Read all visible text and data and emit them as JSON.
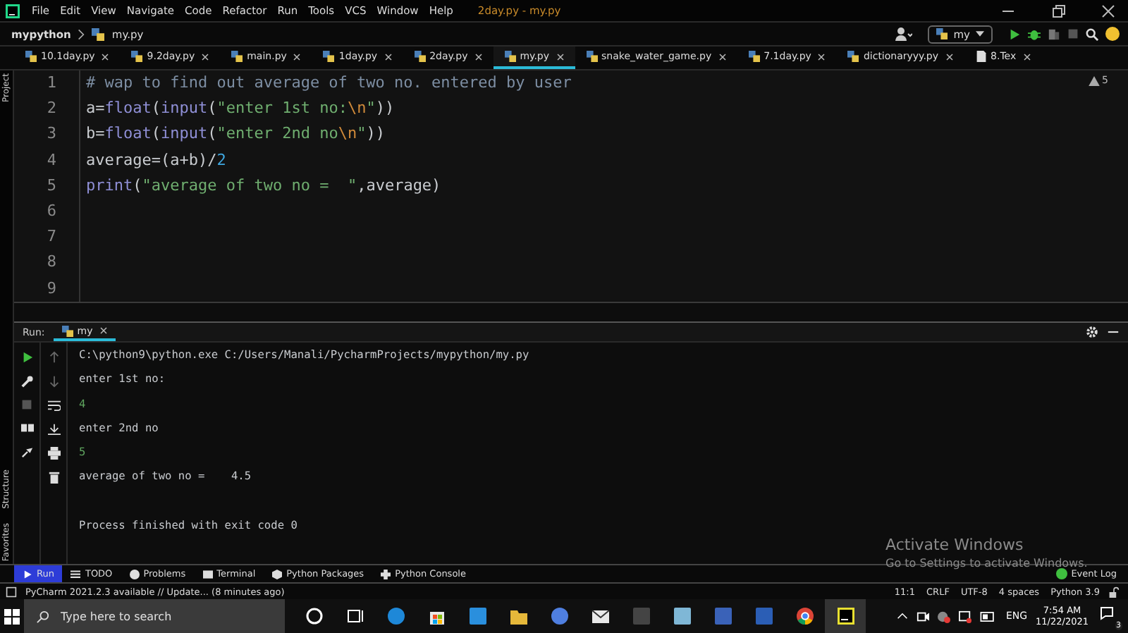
{
  "menu_bar": {
    "items": [
      "File",
      "Edit",
      "View",
      "Navigate",
      "Code",
      "Refactor",
      "Run",
      "Tools",
      "VCS",
      "Window",
      "Help"
    ],
    "title": "2day.py - my.py"
  },
  "nav_bar": {
    "project": "mypython",
    "file": "my.py",
    "run_config": "my"
  },
  "editor_tabs": [
    {
      "label": "10.1day.py",
      "kind": "python",
      "selected": false
    },
    {
      "label": "9.2day.py",
      "kind": "python",
      "selected": false
    },
    {
      "label": "main.py",
      "kind": "python",
      "selected": false
    },
    {
      "label": "1day.py",
      "kind": "python",
      "selected": false
    },
    {
      "label": "2day.py",
      "kind": "python",
      "selected": false
    },
    {
      "label": "my.py",
      "kind": "python",
      "selected": true
    },
    {
      "label": "snake_water_game.py",
      "kind": "python",
      "selected": false
    },
    {
      "label": "7.1day.py",
      "kind": "python",
      "selected": false
    },
    {
      "label": "dictionaryyy.py",
      "kind": "python",
      "selected": false
    },
    {
      "label": "8.Tex",
      "kind": "text",
      "selected": false
    }
  ],
  "side_tabs": [
    "Project",
    "Structure",
    "Favorites"
  ],
  "editor": {
    "warnings": "5",
    "lines": [
      {
        "number": "1",
        "tokens": [
          {
            "kind": "comment",
            "text": "# wap to find out average of two no. entered by user"
          }
        ]
      },
      {
        "number": "2",
        "tokens": [
          {
            "kind": "plain",
            "text": "a"
          },
          {
            "kind": "plain",
            "text": "="
          },
          {
            "kind": "builtin",
            "text": "float"
          },
          {
            "kind": "plain",
            "text": "("
          },
          {
            "kind": "builtin",
            "text": "input"
          },
          {
            "kind": "plain",
            "text": "("
          },
          {
            "kind": "string",
            "text": "\"enter 1st no:"
          },
          {
            "kind": "escape",
            "text": "\\n"
          },
          {
            "kind": "string",
            "text": "\""
          },
          {
            "kind": "plain",
            "text": "))"
          }
        ]
      },
      {
        "number": "3",
        "tokens": [
          {
            "kind": "plain",
            "text": "b"
          },
          {
            "kind": "plain",
            "text": "="
          },
          {
            "kind": "builtin",
            "text": "float"
          },
          {
            "kind": "plain",
            "text": "("
          },
          {
            "kind": "builtin",
            "text": "input"
          },
          {
            "kind": "plain",
            "text": "("
          },
          {
            "kind": "string",
            "text": "\"enter 2nd no"
          },
          {
            "kind": "escape",
            "text": "\\n"
          },
          {
            "kind": "string",
            "text": "\""
          },
          {
            "kind": "plain",
            "text": "))"
          }
        ]
      },
      {
        "number": "4",
        "tokens": [
          {
            "kind": "plain",
            "text": "average=(a+b)/"
          },
          {
            "kind": "number",
            "text": "2"
          }
        ]
      },
      {
        "number": "5",
        "tokens": [
          {
            "kind": "builtin",
            "text": "print"
          },
          {
            "kind": "plain",
            "text": "("
          },
          {
            "kind": "string",
            "text": "\"average of two no =  \""
          },
          {
            "kind": "plain",
            "text": ",average)"
          }
        ]
      },
      {
        "number": "6"
      },
      {
        "number": "7"
      },
      {
        "number": "8"
      },
      {
        "number": "9"
      }
    ]
  },
  "run_panel": {
    "label": "Run:",
    "tab": "my",
    "output": [
      {
        "kind": "stdout",
        "text": "C:\\python9\\python.exe C:/Users/Manali/PycharmProjects/mypython/my.py"
      },
      {
        "kind": "stdout",
        "text": "enter 1st no:"
      },
      {
        "kind": "input",
        "text": "4"
      },
      {
        "kind": "stdout",
        "text": "enter 2nd no"
      },
      {
        "kind": "input",
        "text": "5"
      },
      {
        "kind": "stdout",
        "text": "average of two no =    4.5"
      },
      {
        "kind": "blank"
      },
      {
        "kind": "stdout",
        "text": "Process finished with exit code 0"
      }
    ]
  },
  "tool_windows": [
    {
      "label": "Run",
      "selected": true
    },
    {
      "label": "TODO",
      "selected": false
    },
    {
      "label": "Problems",
      "selected": false
    },
    {
      "label": "Terminal",
      "selected": false
    },
    {
      "label": "Python Packages",
      "selected": false
    },
    {
      "label": "Python Console",
      "selected": false
    }
  ],
  "event_log": "Event Log",
  "status_bar": {
    "message": "PyCharm 2021.2.3 available // Update... (8 minutes ago)",
    "items": [
      "11:1",
      "CRLF",
      "UTF-8",
      "4 spaces",
      "Python 3.9"
    ]
  },
  "activation": {
    "title": "Activate Windows",
    "subtitle": "Go to Settings to activate Windows."
  },
  "taskbar": {
    "search_placeholder": "Type here to search",
    "language": "ENG",
    "time": "7:54 AM",
    "date": "11/22/2021",
    "notifications": "3"
  }
}
